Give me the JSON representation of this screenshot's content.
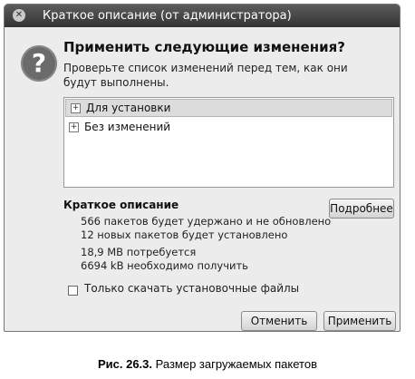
{
  "window": {
    "title": "Краткое описание (от администратора)"
  },
  "dialog": {
    "heading": "Применить следующие изменения?",
    "description": "Проверьте список изменений перед тем, как они будут выполнены.",
    "icon": "question-icon"
  },
  "changes": {
    "items": [
      {
        "label": "Для установки",
        "selected": true
      },
      {
        "label": "Без изменений",
        "selected": false
      }
    ]
  },
  "summary": {
    "title": "Краткое описание",
    "details_button": "Подробнее",
    "lines": [
      "566 пакетов будет удержано и не обновлено",
      "12 новых пакетов будет установлено",
      "18,9 MB потребуется",
      "6694 kB необходимо получить"
    ]
  },
  "options": {
    "download_only_label": "Только скачать установочные файлы",
    "download_only_checked": false
  },
  "buttons": {
    "cancel": "Отменить",
    "apply": "Применить"
  },
  "caption": {
    "number": "Рис. 26.3.",
    "text": "Размер загружаемых пакетов"
  }
}
